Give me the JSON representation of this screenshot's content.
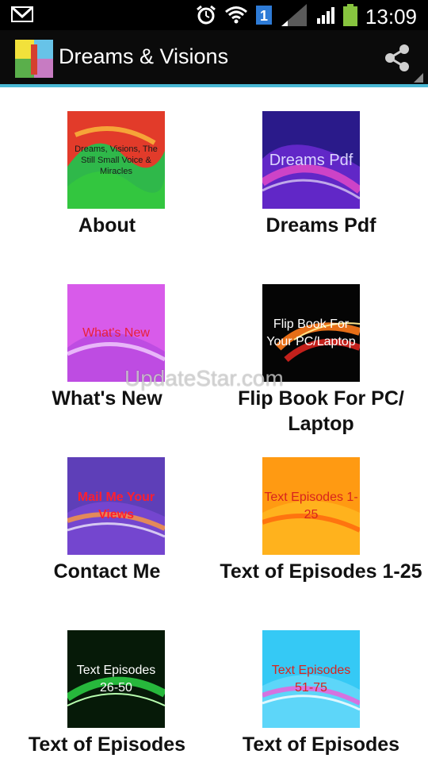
{
  "status_bar": {
    "time": "13:09",
    "icons": [
      "gmail-icon",
      "alarm-icon",
      "wifi-icon",
      "sim-1-icon",
      "signal-weak-icon",
      "signal-bars-icon",
      "battery-icon"
    ]
  },
  "app_bar": {
    "title": "Dreams & Visions",
    "share_icon": "share-icon"
  },
  "tiles": [
    {
      "label": "About",
      "thumb_text": "Dreams, Visions, The Still Small Voice & Miracles"
    },
    {
      "label": "Dreams Pdf",
      "thumb_text": "Dreams Pdf"
    },
    {
      "label": "What's New",
      "thumb_text": "What's New"
    },
    {
      "label": "Flip Book For PC/ Laptop",
      "thumb_text": "Flip Book For Your PC/Laptop"
    },
    {
      "label": "Contact Me",
      "thumb_text": "Mail Me Your Views"
    },
    {
      "label": "Text of Episodes 1-25",
      "thumb_text": "Text Episodes 1-25"
    },
    {
      "label": "Text of Episodes",
      "thumb_text": "Text Episodes 26-50"
    },
    {
      "label": "Text of Episodes",
      "thumb_text": "Text Episodes 51-75"
    }
  ],
  "watermark": "UpdateStar.com",
  "colors": {
    "accent": "#49b8d4",
    "appbar": "#0b0b0b"
  }
}
